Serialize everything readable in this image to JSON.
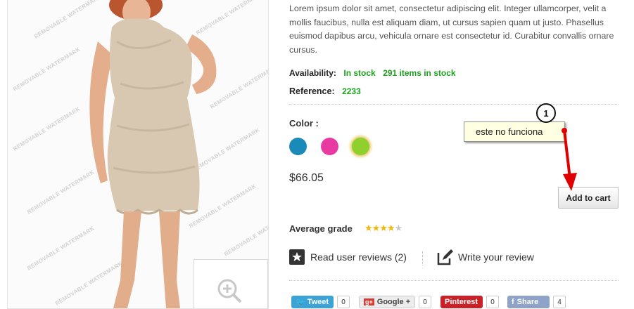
{
  "product": {
    "watermark_text": "REMOVABLE WATERMARK",
    "description": "Lorem ipsum dolor sit amet, consectetur adipiscing elit. Integer ullamcorper, velit a mollis faucibus, nulla est aliquam diam, ut cursus sapien quam ut justo. Phasellus euismod dapibus arcu, vehicula ornare est consectetur id. Curabitur convallis ornare cursus.",
    "availability_label": "Availability:",
    "availability_value": "In stock",
    "stock_count": "291 items in stock",
    "reference_label": "Reference:",
    "reference_value": "2233",
    "color_label": "Color :",
    "colors": [
      "#1a8ab8",
      "#e83aa0",
      "#8fcf2e"
    ],
    "price": "$66.05",
    "add_to_cart_label": "Add to cart",
    "average_grade_label": "Average grade",
    "rating": 4,
    "rating_max": 5,
    "read_reviews_label": "Read user reviews (2)",
    "write_review_label": "Write your review"
  },
  "annotation": {
    "step_number": "1",
    "note_text": "este no funciona",
    "arrow_color": "#e00000"
  },
  "share": {
    "tweet_label": "Tweet",
    "tweet_count": "0",
    "google_label": "Google +",
    "google_count": "0",
    "pinterest_label": "Pinterest",
    "pinterest_count": "0",
    "facebook_label": "Share",
    "facebook_count": "4"
  }
}
